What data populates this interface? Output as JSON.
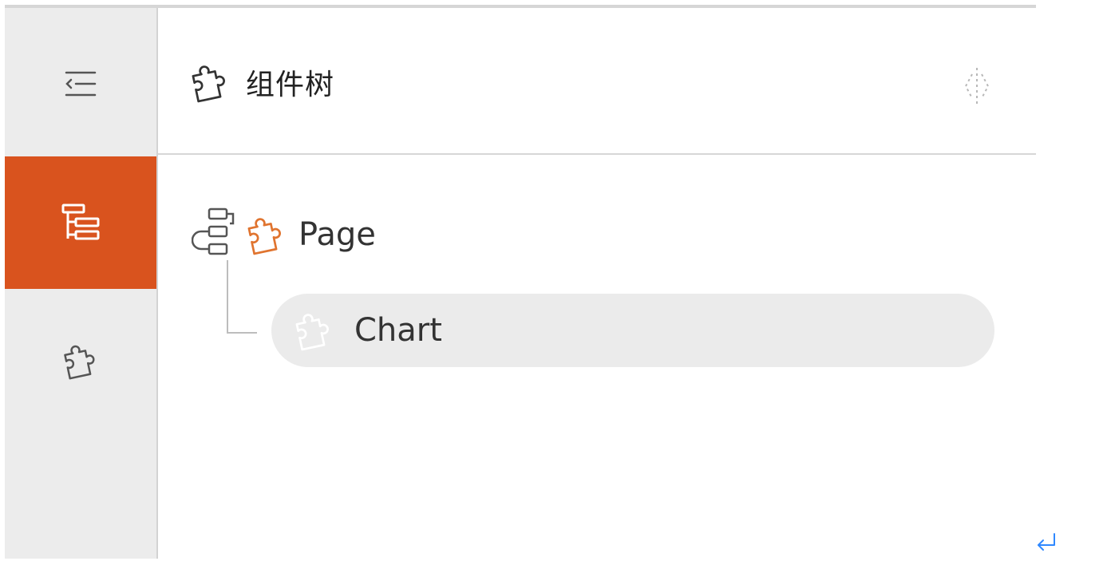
{
  "panel": {
    "title": "组件树",
    "title_icon": "puzzle-icon",
    "header_tool_icon": "split-view-icon"
  },
  "rail": {
    "items": [
      {
        "icon": "collapse-menu-icon",
        "active": false
      },
      {
        "icon": "tree-structure-icon",
        "active": true
      },
      {
        "icon": "puzzle-icon",
        "active": false
      }
    ]
  },
  "tree": {
    "root": {
      "label": "Page",
      "icon": "puzzle-icon"
    },
    "children": [
      {
        "label": "Chart",
        "icon": "puzzle-icon",
        "selected": true
      }
    ]
  },
  "colors": {
    "accent": "#d9531e",
    "rail_bg": "#ececec",
    "selected_row": "#ebebeb",
    "icon_stroke": "#444444",
    "return_icon": "#2f88ff"
  }
}
